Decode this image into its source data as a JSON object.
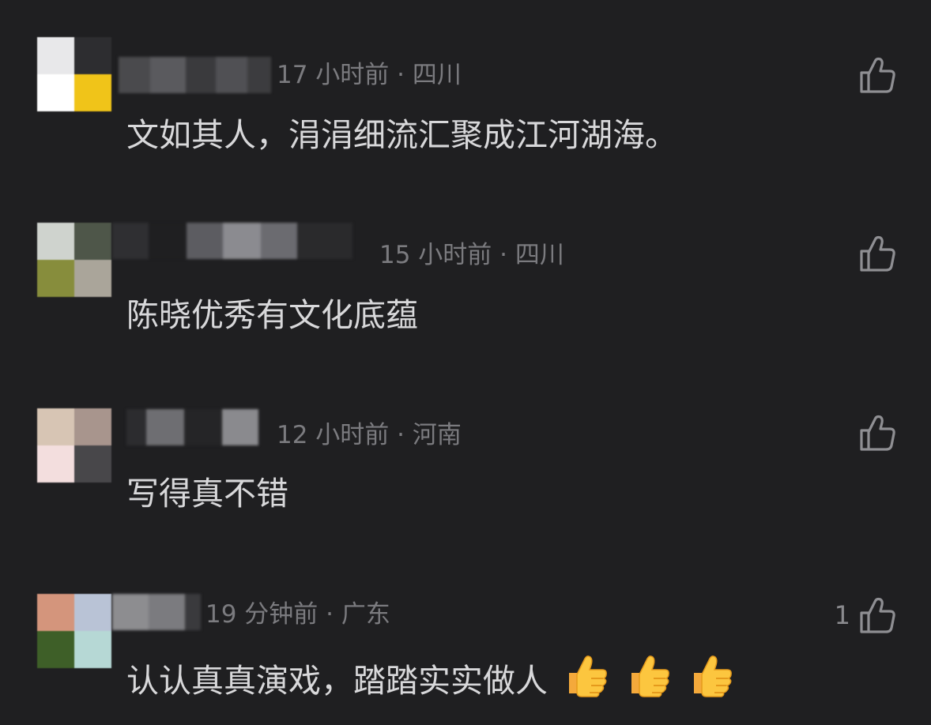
{
  "comments": [
    {
      "meta": "17 小时前 · 四川",
      "text": "文如其人，涓涓细流汇聚成江河湖海。",
      "likes": "",
      "avatar_colors": [
        "#e8e8ea",
        "#2d2d30",
        "#ffffff",
        "#f0c419"
      ],
      "name_mask_colors": [
        "#4a4a4d",
        "#5a5a5e",
        "#3a3a3d",
        "#505054",
        "#3c3c3f"
      ]
    },
    {
      "meta": "15 小时前 · 四川",
      "text": "陈晓优秀有文化底蕴",
      "likes": "",
      "avatar_colors": [
        "#cfd3ce",
        "#4e5649",
        "#878d3c",
        "#aaa59a"
      ],
      "name_mask_colors": [
        "#2f2f32",
        "#1f1f21",
        "#5c5c61",
        "#8b8b90",
        "#6b6b70",
        "#2a2a2c"
      ]
    },
    {
      "meta": "12 小时前 · 河南",
      "text": "写得真不错",
      "likes": "",
      "avatar_colors": [
        "#d7c5b4",
        "#a8958d",
        "#f3dede",
        "#48474a"
      ],
      "name_mask_colors": [
        "#2c2c2f",
        "#6e6e72",
        "#252527",
        "#8a8a8e"
      ]
    },
    {
      "meta": "19 分钟前 · 广东",
      "text": "认认真真演戏，踏踏实实做人",
      "likes": "1",
      "avatar_colors": [
        "#d4957c",
        "#b9c3d6",
        "#3e5f28",
        "#b6d8d5"
      ],
      "name_mask_colors": [
        "#8d8d90",
        "#7b7b7f",
        "#3a3a3d"
      ]
    }
  ],
  "icons": {
    "like": "thumbs-up-outline-icon",
    "emoji": "thumbs-up-emoji-icon"
  }
}
